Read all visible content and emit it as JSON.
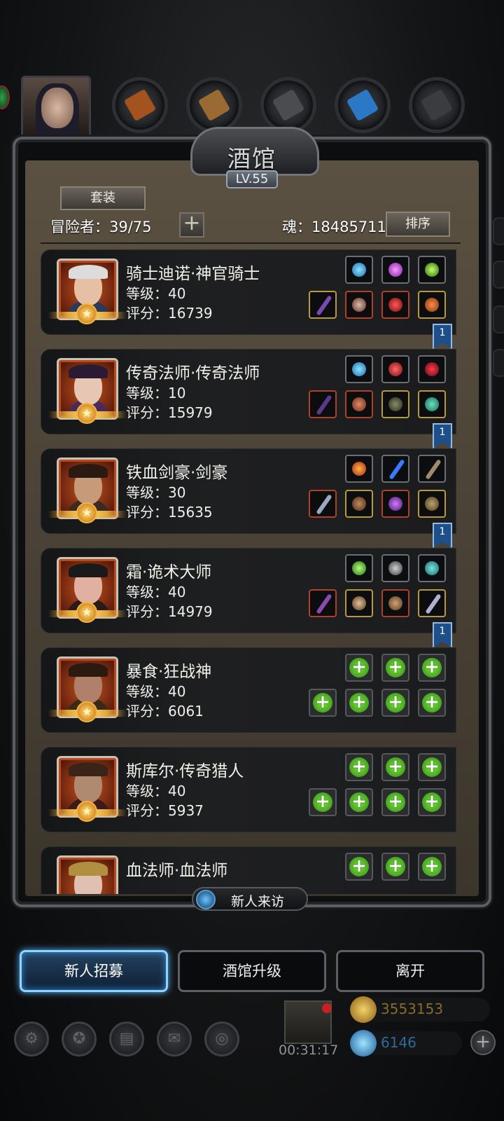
{
  "panel": {
    "title": "酒馆",
    "level": "LV.55",
    "set_button": "套装",
    "adventurer_label": "冒险者：39/75",
    "add_symbol": "+",
    "soul_label": "魂：18485711",
    "sort_button": "排序"
  },
  "heroes": [
    {
      "name": "骑士迪诺·神官骑士",
      "level": "等级：40",
      "score": "评分：16739",
      "star": "★"
    },
    {
      "name": "传奇法师·传奇法师",
      "level": "等级：10",
      "score": "评分：15979",
      "star": "★",
      "bookmark": "1"
    },
    {
      "name": "铁血剑豪·剑豪",
      "level": "等级：30",
      "score": "评分：15635",
      "star": "★",
      "bookmark": "1"
    },
    {
      "name": "霜·诡术大师",
      "level": "等级：40",
      "score": "评分：14979",
      "star": "★",
      "bookmark": "1"
    },
    {
      "name": "暴食·狂战神",
      "level": "等级：40",
      "score": "评分：6061",
      "star": "★",
      "bookmark": "1"
    },
    {
      "name": "斯库尔·传奇猎人",
      "level": "等级：40",
      "score": "评分：5937",
      "star": "★"
    },
    {
      "name": "血法师·血法师",
      "star": "★"
    }
  ],
  "visitor": {
    "label": "新人来访"
  },
  "actions": {
    "recruit": "新人招募",
    "upgrade": "酒馆升级",
    "leave": "离开"
  },
  "footer": {
    "timer": "00:31:17",
    "gold": "3553153",
    "gems": "6146",
    "plus_symbol": "+",
    "gold_color": "#8a6a2a",
    "gem_color": "#2f6a9a"
  }
}
